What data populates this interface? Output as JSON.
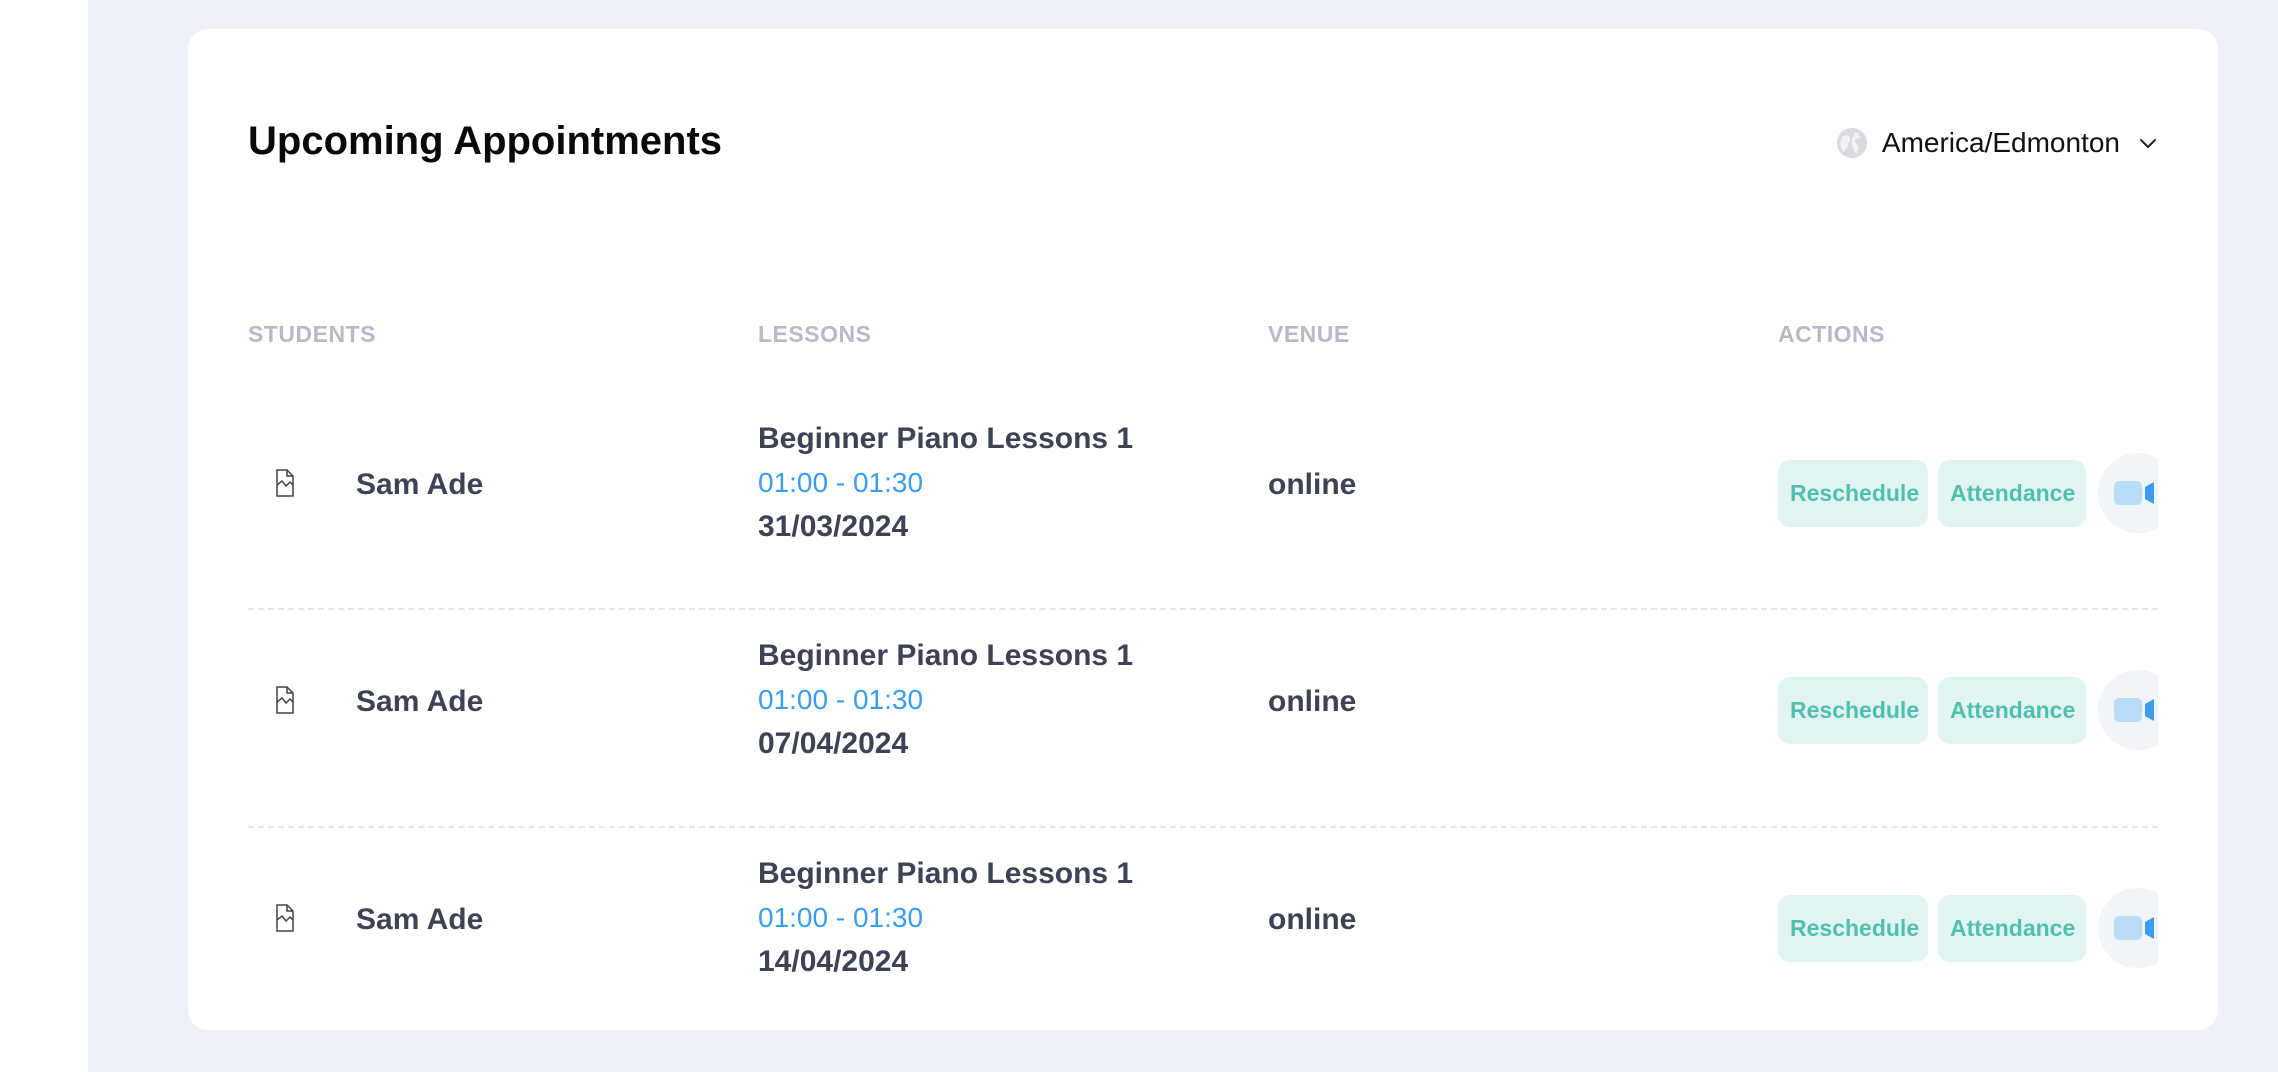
{
  "header": {
    "title": "Upcoming Appointments",
    "timezone": "America/Edmonton"
  },
  "table": {
    "columns": [
      "STUDENTS",
      "LESSONS",
      "VENUE",
      "ACTIONS"
    ],
    "rows": [
      {
        "student": "Sam Ade",
        "lesson_title": "Beginner Piano Lessons 1",
        "time": "01:00 - 01:30",
        "date": "31/03/2024",
        "venue": "online",
        "reschedule_label": "Reschedule",
        "attendance_label": "Attendance"
      },
      {
        "student": "Sam Ade",
        "lesson_title": "Beginner Piano Lessons 1",
        "time": "01:00 - 01:30",
        "date": "07/04/2024",
        "venue": "online",
        "reschedule_label": "Reschedule",
        "attendance_label": "Attendance"
      },
      {
        "student": "Sam Ade",
        "lesson_title": "Beginner Piano Lessons 1",
        "time": "01:00 - 01:30",
        "date": "14/04/2024",
        "venue": "online",
        "reschedule_label": "Reschedule",
        "attendance_label": "Attendance"
      }
    ]
  },
  "icons": {
    "timezone": "globe-icon",
    "dropdown": "chevron-down-icon",
    "avatar": "broken-image-icon",
    "video": "video-camera-icon"
  },
  "colors": {
    "page_background": "#eff0f8",
    "card_background": "#ffffff",
    "header_text": "#b6b9c6",
    "body_text": "#3f4254",
    "time_text": "#3b9cf0",
    "action_button_bg": "#e2f4f2",
    "action_button_text": "#4fc0b0",
    "video_icon": "#3b9cf0"
  }
}
